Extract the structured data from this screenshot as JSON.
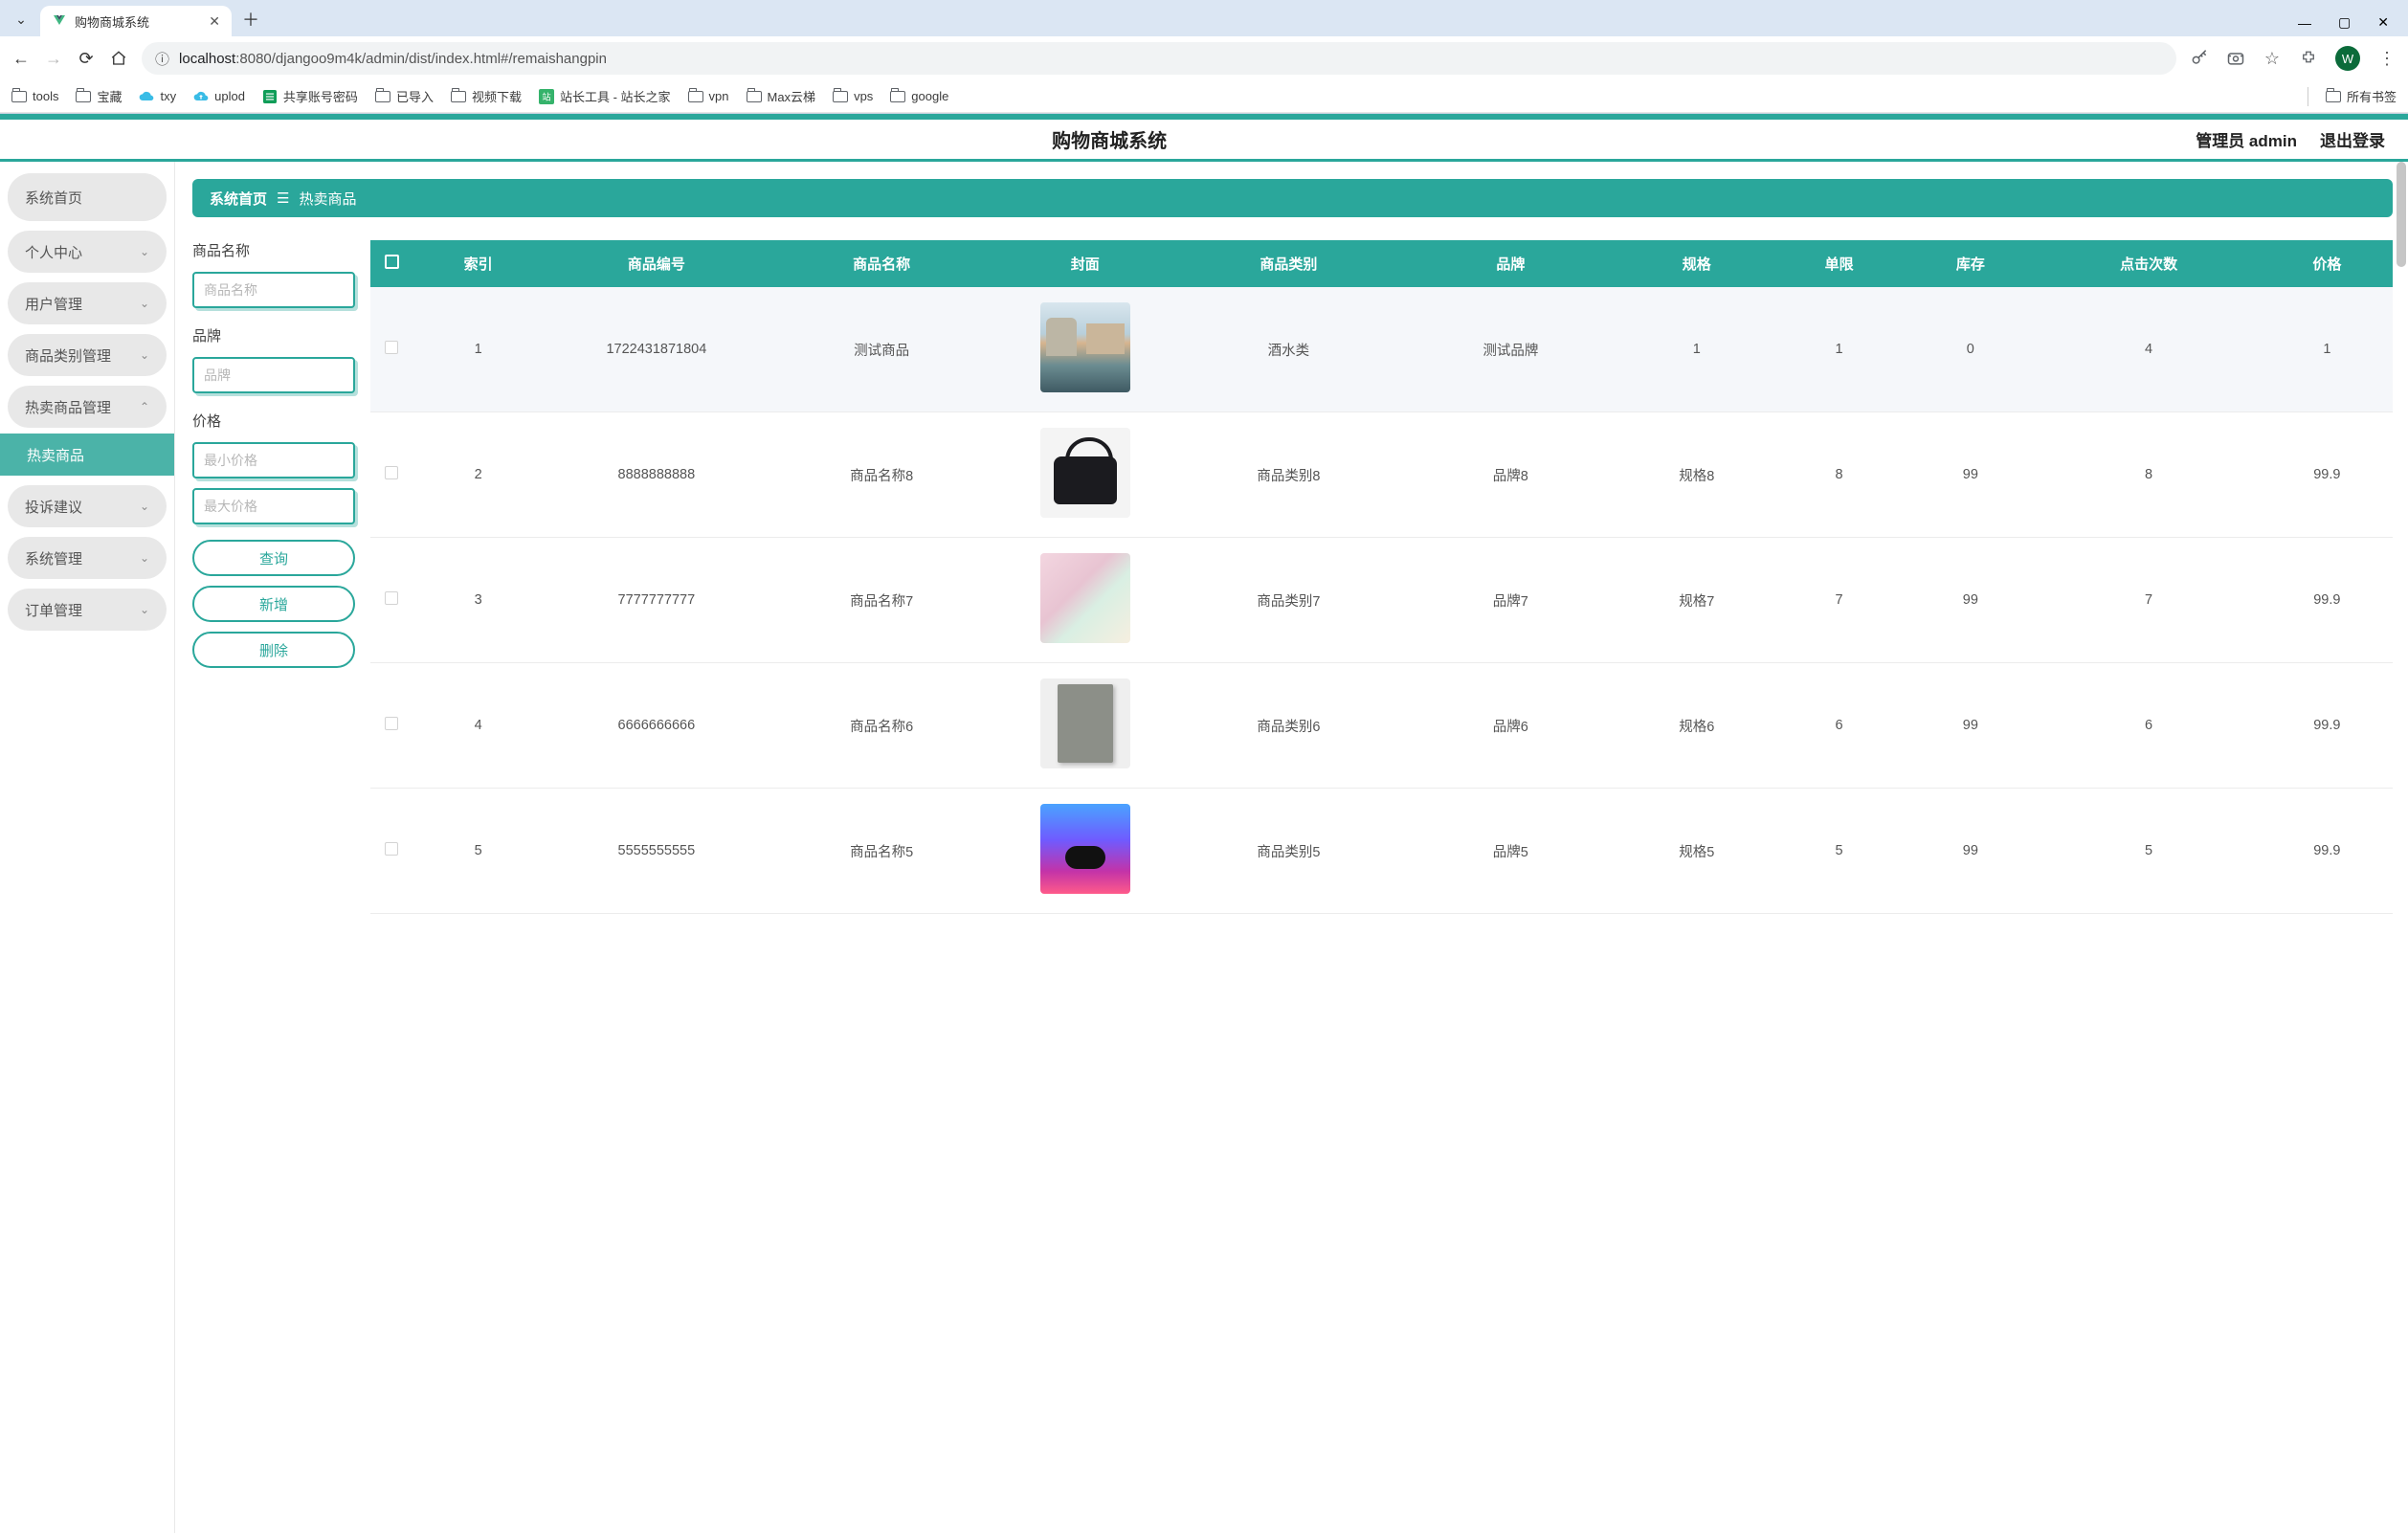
{
  "browser": {
    "tab_title": "购物商城系统",
    "url_display_host": "localhost",
    "url_display_rest": ":8080/djangoo9m4k/admin/dist/index.html#/remaishangpin",
    "profile_initial": "W",
    "bookmarks": [
      "tools",
      "宝藏",
      "txy",
      "uplod",
      "共享账号密码",
      "已导入",
      "视频下载",
      "站长工具 - 站长之家",
      "vpn",
      "Max云梯",
      "vps",
      "google"
    ],
    "all_bookmarks": "所有书签"
  },
  "app": {
    "title": "购物商城系统",
    "admin_label": "管理员 admin",
    "logout": "退出登录"
  },
  "sidebar": {
    "items": [
      {
        "label": "系统首页",
        "expandable": false
      },
      {
        "label": "个人中心",
        "expandable": true
      },
      {
        "label": "用户管理",
        "expandable": true
      },
      {
        "label": "商品类别管理",
        "expandable": true
      },
      {
        "label": "热卖商品管理",
        "expandable": true,
        "expanded": true,
        "children": [
          {
            "label": "热卖商品",
            "active": true
          }
        ]
      },
      {
        "label": "投诉建议",
        "expandable": true
      },
      {
        "label": "系统管理",
        "expandable": true
      },
      {
        "label": "订单管理",
        "expandable": true
      }
    ]
  },
  "breadcrumb": {
    "home": "系统首页",
    "current": "热卖商品"
  },
  "filters": {
    "name_label": "商品名称",
    "name_placeholder": "商品名称",
    "brand_label": "品牌",
    "brand_placeholder": "品牌",
    "price_label": "价格",
    "min_price_placeholder": "最小价格",
    "max_price_placeholder": "最大价格",
    "search_btn": "查询",
    "add_btn": "新增",
    "delete_btn": "删除"
  },
  "table": {
    "columns": [
      "索引",
      "商品编号",
      "商品名称",
      "封面",
      "商品类别",
      "品牌",
      "规格",
      "单限",
      "库存",
      "点击次数",
      "价格"
    ],
    "rows": [
      {
        "index": "1",
        "code": "1722431871804",
        "name": "测试商品",
        "thumb": "venice",
        "category": "酒水类",
        "brand": "测试品牌",
        "spec": "1",
        "limit": "1",
        "stock": "0",
        "clicks": "4",
        "price": "1"
      },
      {
        "index": "2",
        "code": "8888888888",
        "name": "商品名称8",
        "thumb": "bag",
        "category": "商品类别8",
        "brand": "品牌8",
        "spec": "规格8",
        "limit": "8",
        "stock": "99",
        "clicks": "8",
        "price": "99.9"
      },
      {
        "index": "3",
        "code": "7777777777",
        "name": "商品名称7",
        "thumb": "plush",
        "category": "商品类别7",
        "brand": "品牌7",
        "spec": "规格7",
        "limit": "7",
        "stock": "99",
        "clicks": "7",
        "price": "99.9"
      },
      {
        "index": "4",
        "code": "6666666666",
        "name": "商品名称6",
        "thumb": "book",
        "category": "商品类别6",
        "brand": "品牌6",
        "spec": "规格6",
        "limit": "6",
        "stock": "99",
        "clicks": "6",
        "price": "99.9"
      },
      {
        "index": "5",
        "code": "5555555555",
        "name": "商品名称5",
        "thumb": "earbuds",
        "category": "商品类别5",
        "brand": "品牌5",
        "spec": "规格5",
        "limit": "5",
        "stock": "99",
        "clicks": "5",
        "price": "99.9"
      }
    ]
  }
}
